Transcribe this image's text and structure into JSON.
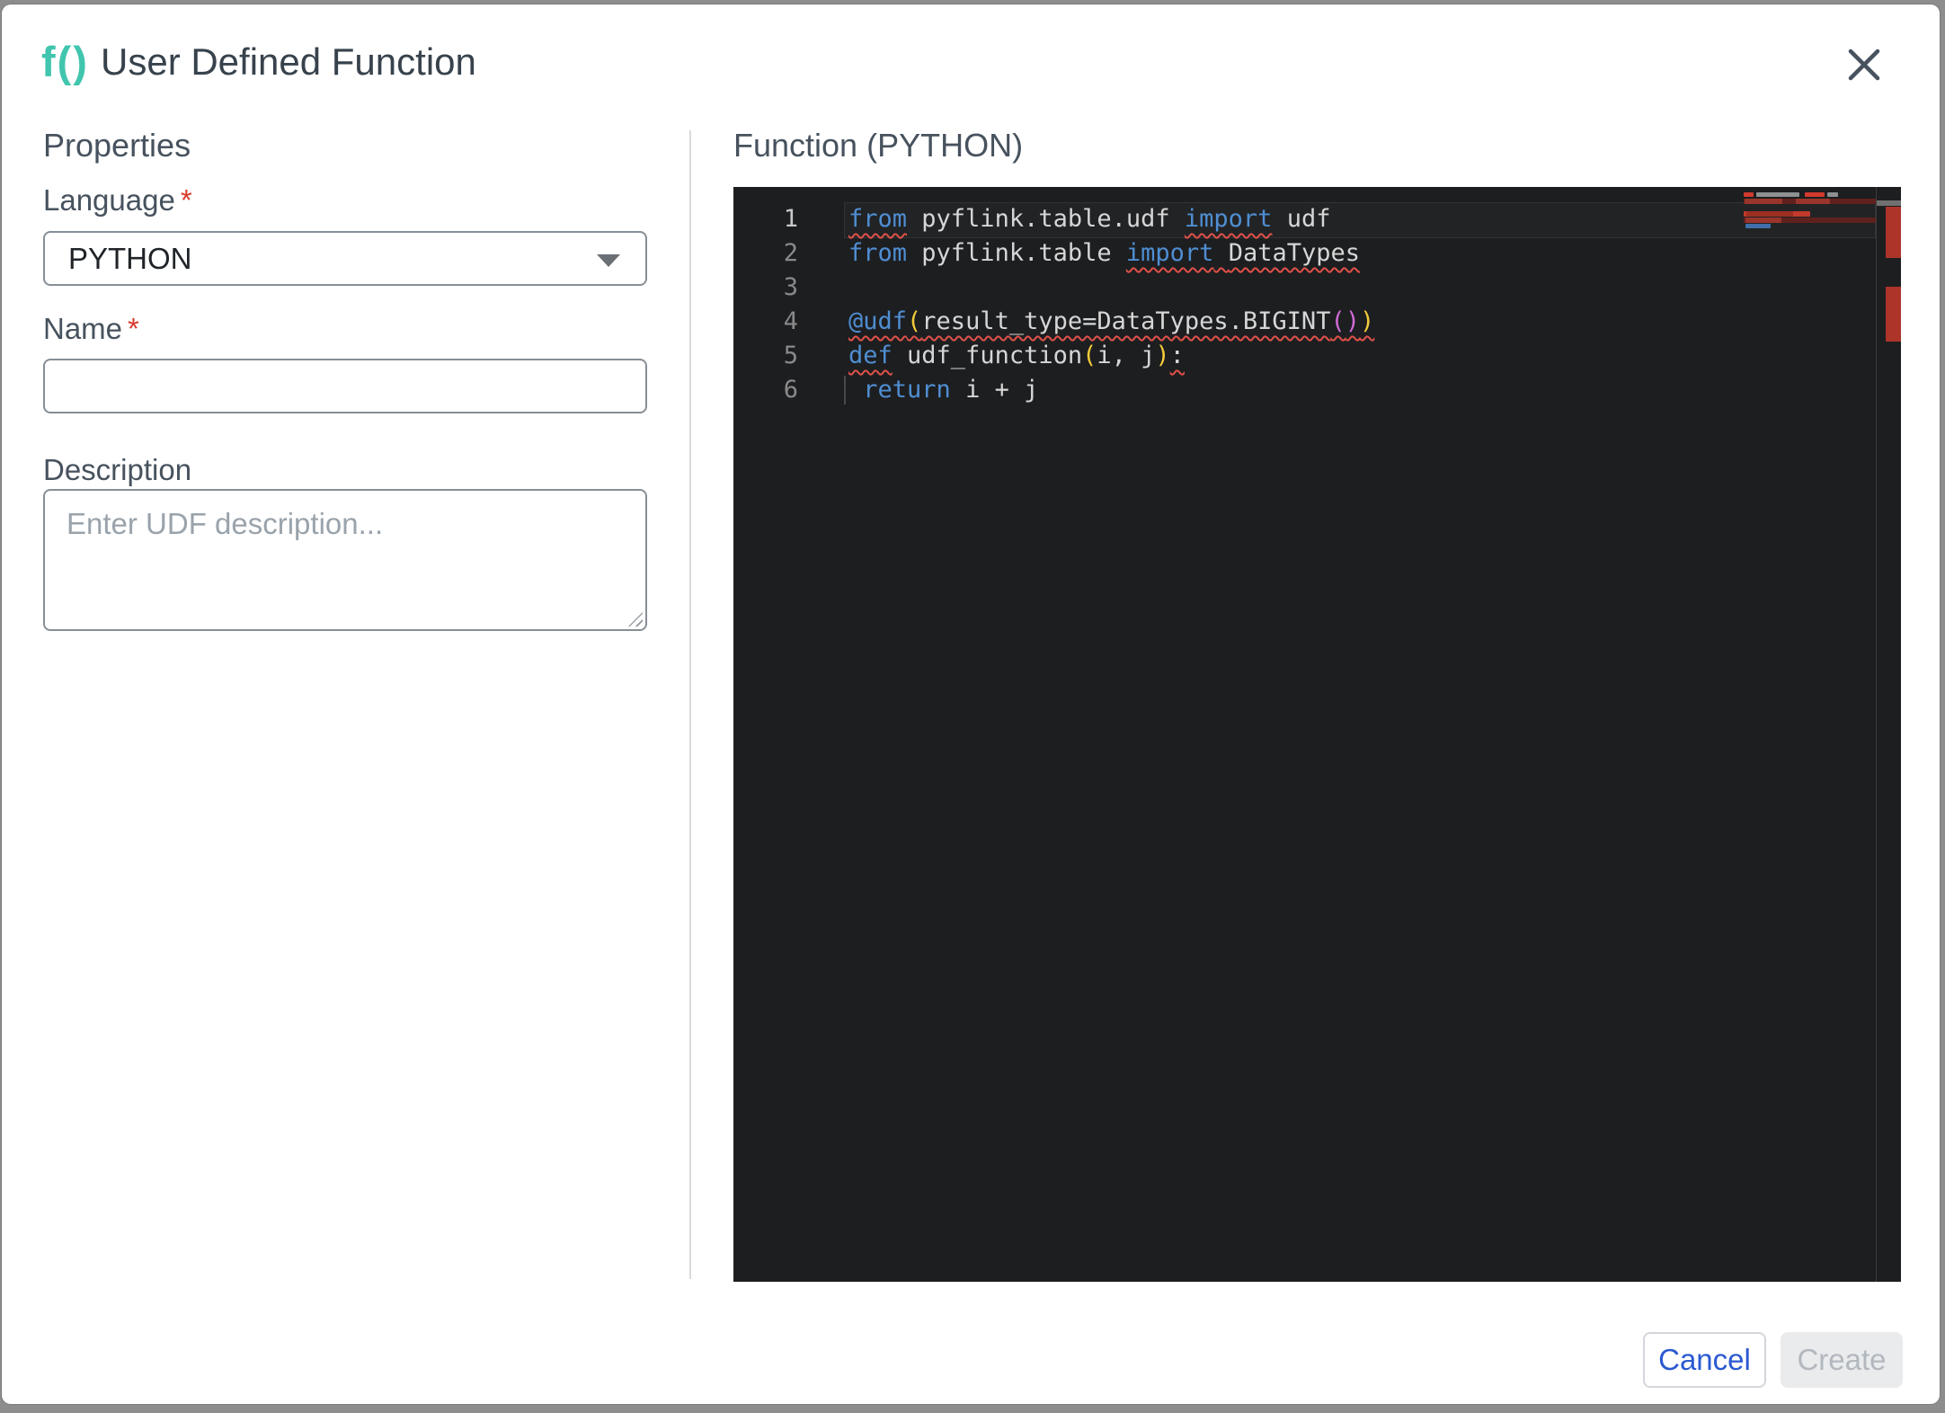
{
  "header": {
    "icon_text": "f()",
    "title": "User Defined Function"
  },
  "left_panel": {
    "heading": "Properties",
    "required_marker": "*",
    "language": {
      "label": "Language",
      "required": true,
      "value": "PYTHON"
    },
    "name": {
      "label": "Name",
      "required": true,
      "value": ""
    },
    "description": {
      "label": "Description",
      "placeholder": "Enter UDF description..."
    }
  },
  "right_panel": {
    "heading": "Function (PYTHON)"
  },
  "editor": {
    "language": "PYTHON",
    "current_line": 1,
    "lines": [
      {
        "num": 1,
        "tokens": [
          {
            "t": "from",
            "c": "kw",
            "e": true
          },
          {
            "t": " pyflink.table.udf "
          },
          {
            "t": "import",
            "c": "kw",
            "e": true
          },
          {
            "t": " udf"
          }
        ]
      },
      {
        "num": 2,
        "tokens": [
          {
            "t": "from",
            "c": "kw"
          },
          {
            "t": " pyflink.table "
          },
          {
            "t": "import",
            "c": "kw",
            "e": true
          },
          {
            "t": " ",
            "e": true
          },
          {
            "t": "DataTypes",
            "e": true
          }
        ]
      },
      {
        "num": 3,
        "tokens": []
      },
      {
        "num": 4,
        "tokens": [
          {
            "t": "@udf",
            "c": "kw",
            "e": true
          },
          {
            "t": "(",
            "c": "b1",
            "e": true
          },
          {
            "t": "result_type=DataTypes.BIGINT",
            "e": true
          },
          {
            "t": "(",
            "c": "b2",
            "e": true
          },
          {
            "t": ")",
            "c": "b2",
            "e": true
          },
          {
            "t": ")",
            "c": "b1",
            "e": true
          }
        ]
      },
      {
        "num": 5,
        "tokens": [
          {
            "t": "def",
            "c": "kw",
            "e": true
          },
          {
            "t": " udf_function"
          },
          {
            "t": "(",
            "c": "b1"
          },
          {
            "t": "i, j"
          },
          {
            "t": ")",
            "c": "b1"
          },
          {
            "t": ":",
            "e": true
          }
        ],
        "guide": false
      },
      {
        "num": 6,
        "guide": true,
        "tokens": [
          {
            "t": " "
          },
          {
            "t": "return",
            "c": "kw"
          },
          {
            "t": " i + j"
          }
        ]
      }
    ],
    "colors": {
      "background": "#1d1e20",
      "keyword_blue": "#4f8ed2",
      "default_text": "#d6d6d6",
      "bracket_gold": "#f3cb3a",
      "bracket_magenta": "#cf6bd6",
      "error_red": "#e05149",
      "minimap_error_red": "#c23a2c",
      "ruler_error_red": "#ad3429"
    }
  },
  "footer": {
    "cancel_label": "Cancel",
    "create_label": "Create"
  },
  "theme": {
    "accent_teal": "#41c5ae",
    "required_red": "#d93a2b",
    "link_blue": "#2b59d1",
    "backdrop_gray": "#8d8d8d"
  }
}
